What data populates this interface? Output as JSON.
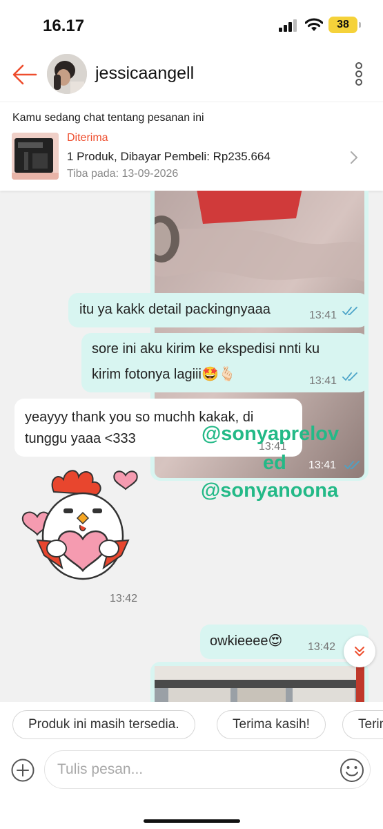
{
  "status_bar": {
    "time": "16.17",
    "battery": "38"
  },
  "header": {
    "username": "jessicaangell"
  },
  "order": {
    "intro": "Kamu sedang chat tentang pesanan ini",
    "status": "Diterima",
    "summary": "1 Produk, Dibayar Pembeli: Rp235.664",
    "arrival": "Tiba pada: 13-09-2026"
  },
  "messages": [
    {
      "type": "image",
      "time": "13:41"
    },
    {
      "type": "text",
      "text": "itu ya kakk detail packingnyaaa",
      "time": "13:41"
    },
    {
      "type": "text",
      "line1": "sore ini aku kirim ke ekspedisi nnti ku",
      "line2": "kirim fotonya lagiii🤩🫰🏻",
      "time": "13:41"
    },
    {
      "type": "text",
      "line1": "yeayyy thank you so muchh kakak, di",
      "line2": "tunggu yaaa <333",
      "time": "13:41"
    },
    {
      "type": "sticker",
      "time": "13:42"
    },
    {
      "type": "text",
      "text": "owkieeee😍",
      "time": "13:42"
    }
  ],
  "watermark": {
    "line1": "@sonyaprelov",
    "line2": "ed",
    "line3": "@sonyanoona"
  },
  "quick_replies": [
    "Produk ini masih tersedia.",
    "Terima kasih!",
    "Terima"
  ],
  "input": {
    "placeholder": "Tulis pesan..."
  },
  "colors": {
    "accent": "#ee4d2d",
    "outgoing_bubble": "#d8f5f1",
    "watermark": "#23b987",
    "ticks": "#4aa3c8"
  }
}
